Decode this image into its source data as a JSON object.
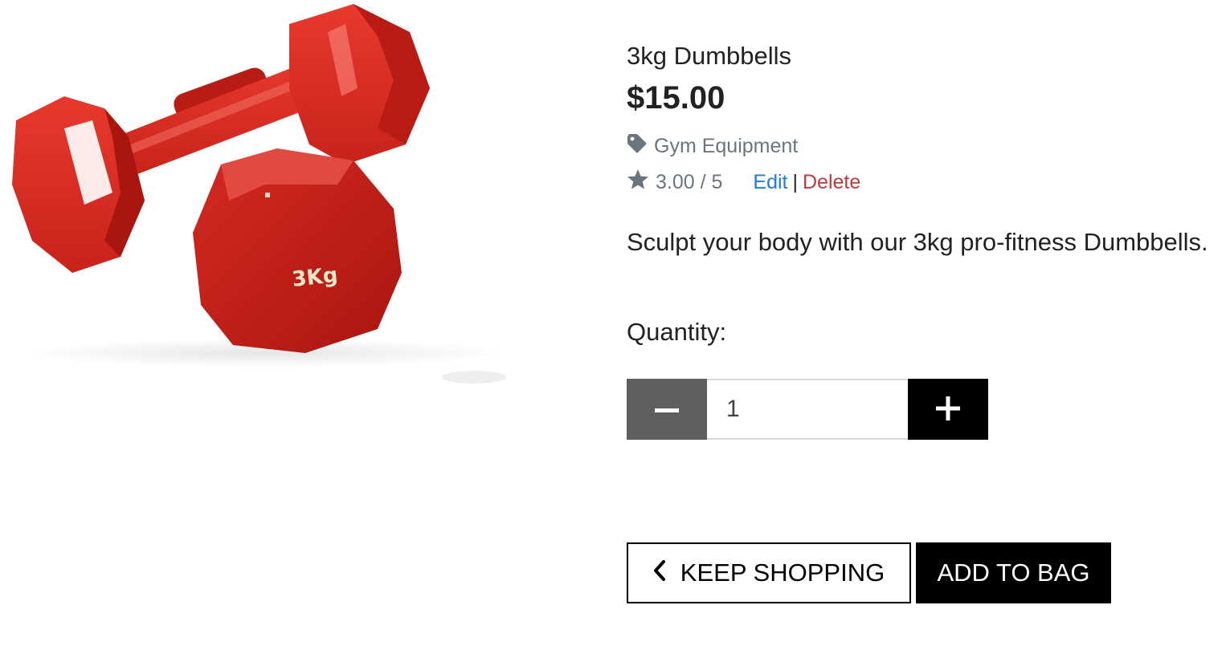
{
  "product": {
    "image_label": "3Kg",
    "name": "3kg Dumbbells",
    "price": "$15.00",
    "category": "Gym Equipment",
    "category_icon": "tag-icon",
    "rating": "3.00 / 5",
    "rating_icon": "star-icon",
    "description": "Sculpt your body with our 3kg pro-fitness Dumbbells."
  },
  "admin": {
    "edit_label": "Edit",
    "separator": "|",
    "delete_label": "Delete"
  },
  "quantity": {
    "label": "Quantity:",
    "value": "1",
    "decrement_icon": "minus-icon",
    "increment_icon": "plus-icon"
  },
  "actions": {
    "keep_shopping_label": "KEEP SHOPPING",
    "keep_shopping_icon": "chevron-left-icon",
    "add_to_bag_label": "ADD TO BAG"
  },
  "colors": {
    "product_red": "#d8261f",
    "link_blue": "#1e7bd7",
    "delete_red": "#c0393f",
    "muted_gray": "#6c757d",
    "minus_bg": "#5f5f5f",
    "plus_bg": "#000000"
  }
}
